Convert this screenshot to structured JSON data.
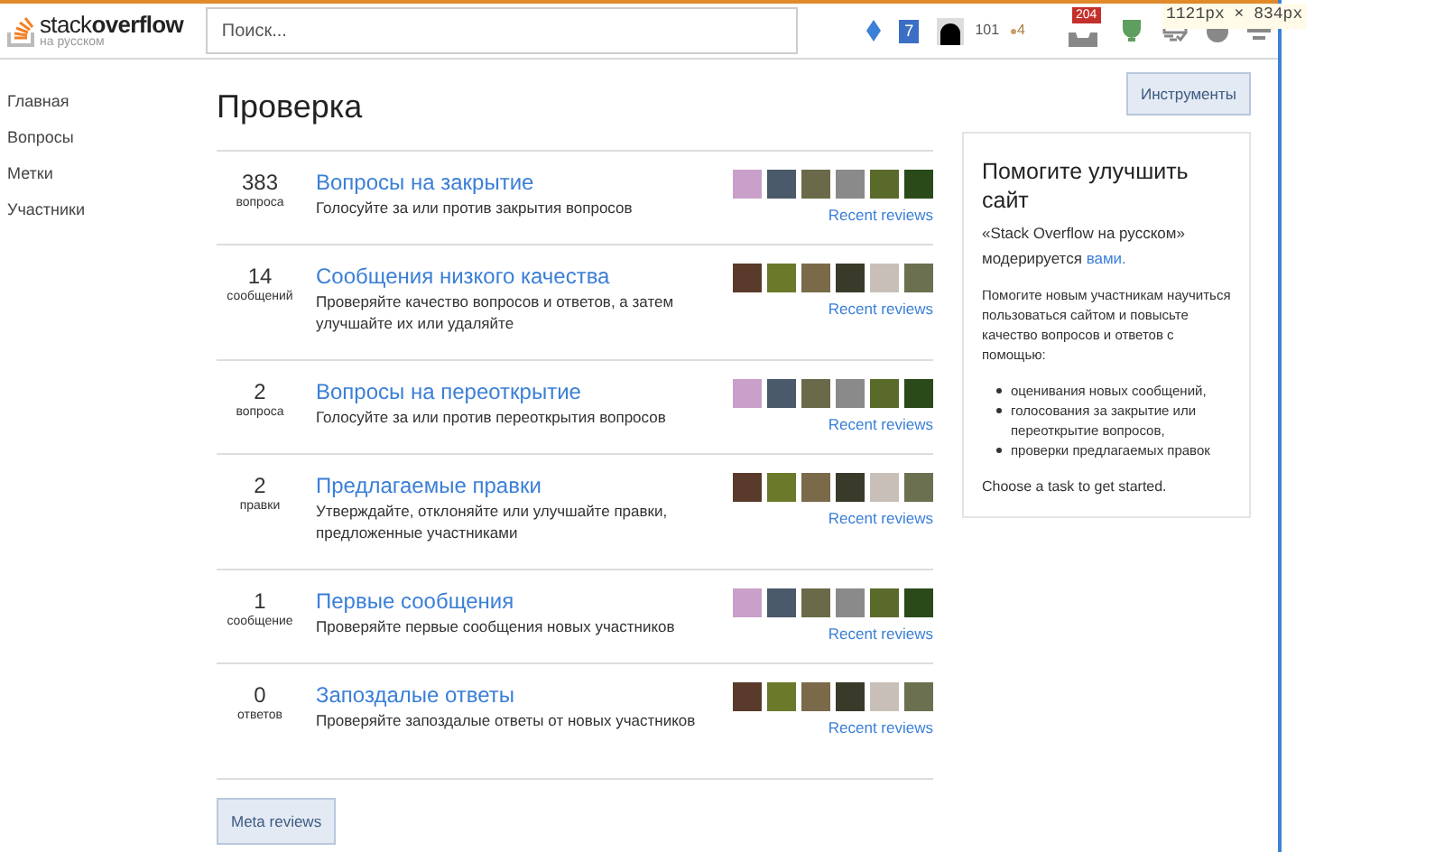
{
  "header": {
    "logo_word_1": "stack",
    "logo_word_2": "overflow",
    "logo_sub": "на русском",
    "search": {
      "placeholder": "Поиск..."
    },
    "review_badge": "7",
    "reputation": "101",
    "bronze_badges": "4",
    "inbox_count": "204"
  },
  "viewport_size": "1121px × 834px",
  "nav": [
    {
      "label": "Главная"
    },
    {
      "label": "Вопросы"
    },
    {
      "label": "Метки"
    },
    {
      "label": "Участники"
    }
  ],
  "page_title": "Проверка",
  "tools_button": "Инструменты",
  "queues": [
    {
      "count": "383",
      "unit": "вопроса",
      "title": "Вопросы на закрытие",
      "description": "Голосуйте за или против закрытия вопросов",
      "link": "Recent reviews"
    },
    {
      "count": "14",
      "unit": "сообщений",
      "title": "Сообщения низкого качества",
      "description": "Проверяйте качество вопросов и ответов, а затем улучшайте их или удаляйте",
      "link": "Recent reviews"
    },
    {
      "count": "2",
      "unit": "вопроса",
      "title": "Вопросы на переоткрытие",
      "description": "Голосуйте за или против переоткрытия вопросов",
      "link": "Recent reviews"
    },
    {
      "count": "2",
      "unit": "правки",
      "title": "Предлагаемые правки",
      "description": "Утверждайте, отклоняйте или улучшайте правки, предложенные участниками",
      "link": "Recent reviews"
    },
    {
      "count": "1",
      "unit": "сообщение",
      "title": "Первые сообщения",
      "description": "Проверяйте первые сообщения новых участников",
      "link": "Recent reviews"
    },
    {
      "count": "0",
      "unit": "ответов",
      "title": "Запоздалые ответы",
      "description": "Проверяйте запоздалые ответы от новых участников",
      "link": "Recent reviews"
    }
  ],
  "meta_button": "Meta reviews",
  "help_box": {
    "title": "Помогите улучшить сайт",
    "intro_1": "«Stack Overflow на русском»",
    "intro_2": "модерируется",
    "intro_link": "вами.",
    "text": "Помогите новым участникам научиться пользоваться сайтом и повысьте качество вопросов и ответов с помощью:",
    "items": [
      "оценивания новых сообщений,",
      "голосования за закрытие или переоткрытие вопросов,",
      "проверки предлагаемых правок"
    ],
    "footer": "Choose a task to get started."
  }
}
